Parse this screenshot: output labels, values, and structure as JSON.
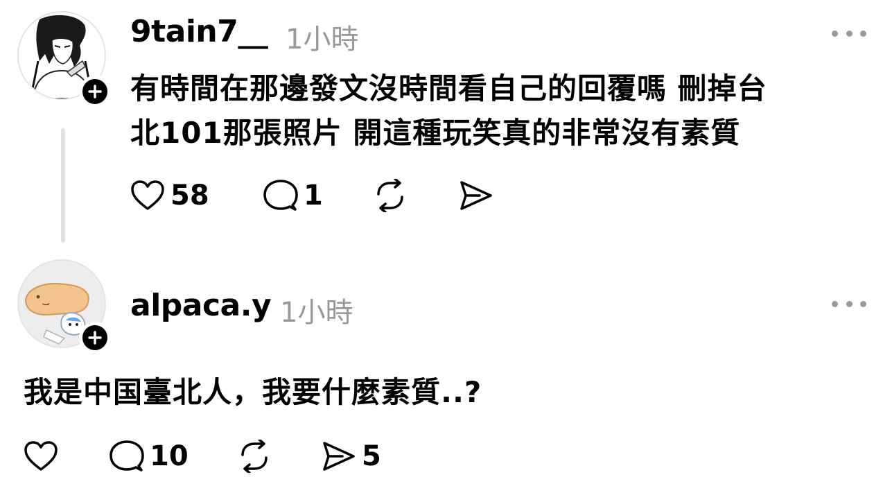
{
  "posts": [
    {
      "username": "9tain7__",
      "time": "1小時",
      "text_lines": [
        "有時間在那邊發文沒時間看自己的回覆嗎 刪掉台",
        "北101那張照片 開這種玩笑真的非常沒有素質"
      ],
      "likes": "58",
      "replies": "1",
      "reposts": "",
      "shares": ""
    },
    {
      "username": "alpaca.y",
      "time": "1小時",
      "text_lines": [
        "我是中国臺北人，我要什麼素質..?"
      ],
      "likes": "",
      "replies": "10",
      "reposts": "",
      "shares": "5"
    }
  ],
  "icons": {
    "like": "heart-icon",
    "reply": "comment-bubble-icon",
    "repost": "repost-icon",
    "share": "send-icon",
    "more": "more-options-icon",
    "follow": "plus-icon"
  }
}
